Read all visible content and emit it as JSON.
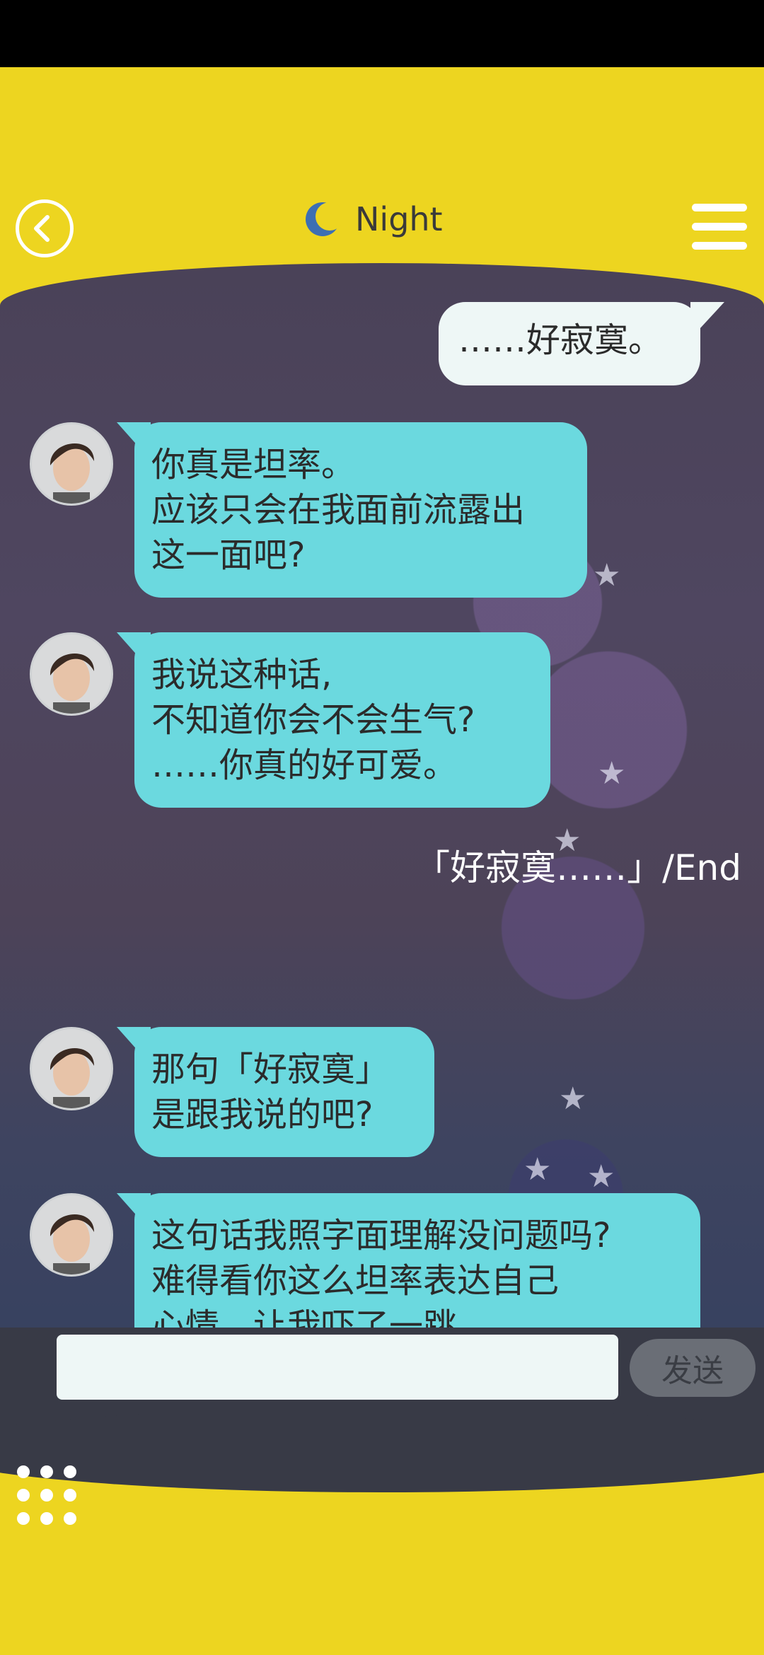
{
  "header": {
    "title": "Night",
    "icons": {
      "back": "back-arrow-icon",
      "moon": "moon-icon",
      "menu": "hamburger-menu-icon"
    }
  },
  "messages": [
    {
      "sender": "me",
      "text": "……好寂寞。"
    },
    {
      "sender": "character",
      "text": "你真是坦率。\n应该只会在我面前流露出\n这一面吧?"
    },
    {
      "sender": "character",
      "text": "我说这种话,\n不知道你会不会生气?\n……你真的好可爱。"
    },
    {
      "sender": "system",
      "text": "「好寂寞……」/End"
    },
    {
      "sender": "character",
      "text": "那句「好寂寞」\n是跟我说的吧?"
    },
    {
      "sender": "character",
      "text": "这句话我照字面理解没问题吗?\n难得看你这么坦率表达自己\n心情，让我吓了一跳"
    }
  ],
  "input": {
    "placeholder": "",
    "send_label": "发送"
  },
  "colors": {
    "background": "#EDD520",
    "bubble_character": "#6BD9DF",
    "bubble_me": "#EEF7F6",
    "input_bar": "#383A46"
  }
}
